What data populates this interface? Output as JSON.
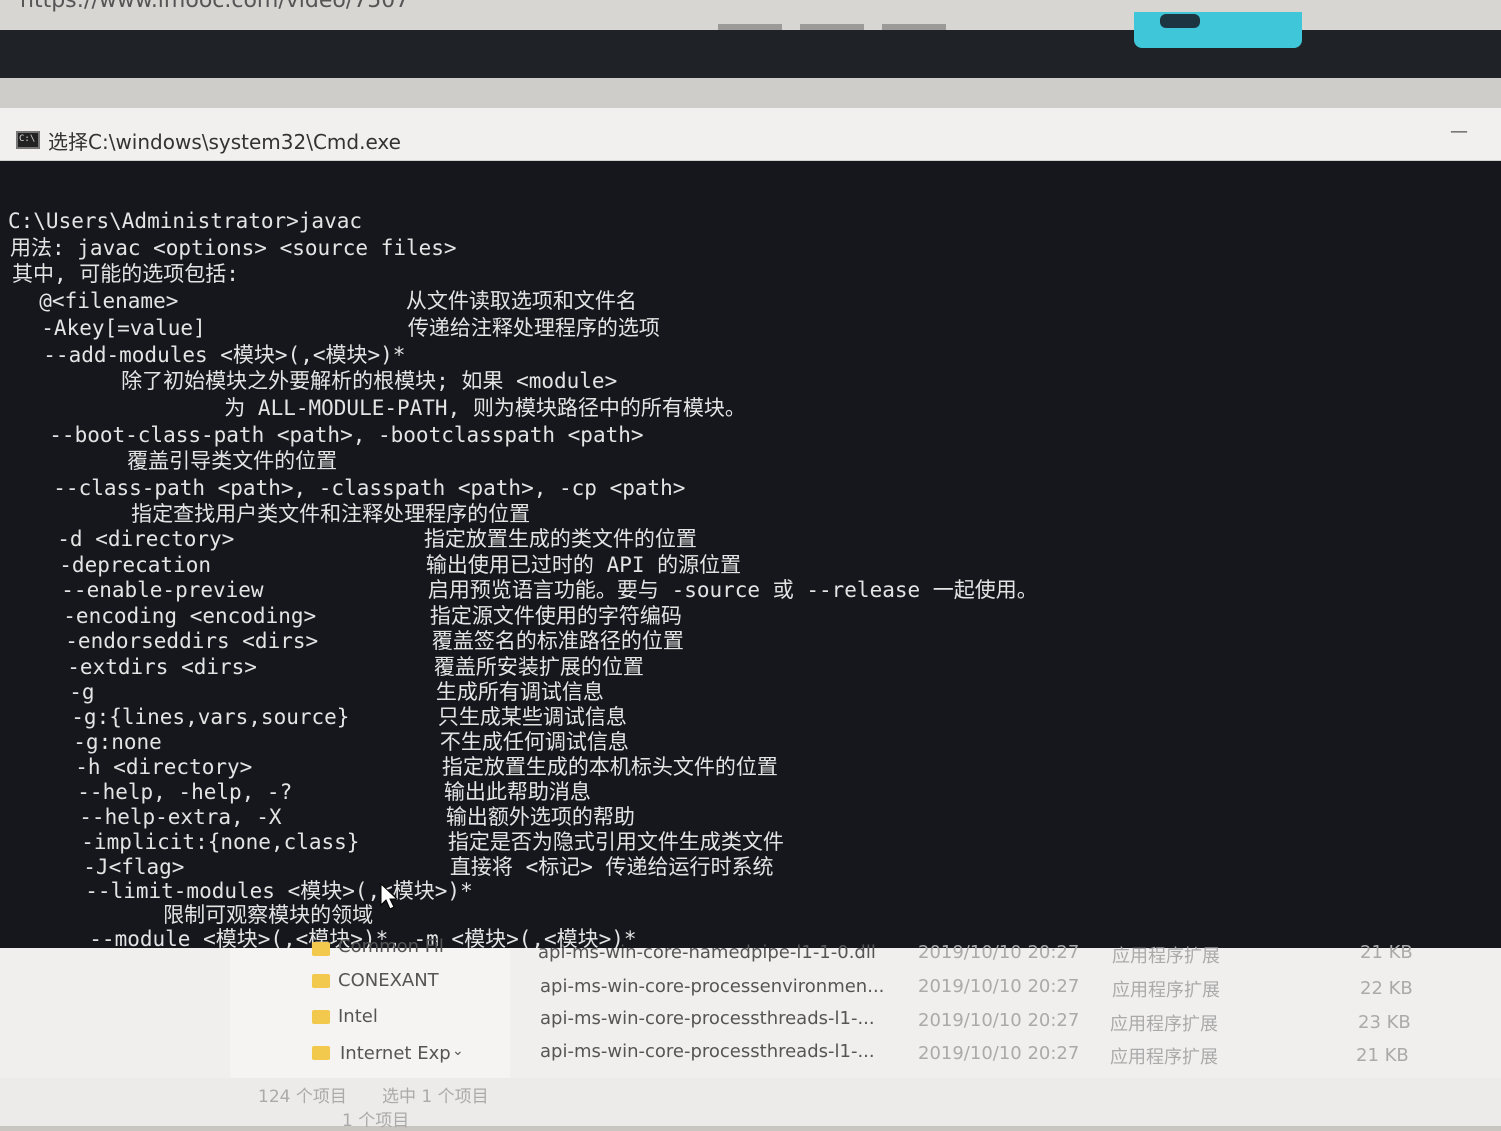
{
  "browser": {
    "url": "https://www.imooc.com/video/7507"
  },
  "window": {
    "title": "选择C:\\windows\\system32\\Cmd.exe",
    "minimize_glyph": "—"
  },
  "console": {
    "lines": [
      "C:\\Users\\Administrator>javac",
      "用法: javac <options> <source files>",
      "其中, 可能的选项包括:",
      "  @<filename>                  从文件读取选项和文件名",
      "  -Akey[=value]                传递给注释处理程序的选项",
      "  --add-modules <模块>(,<模块>)*",
      "        除了初始模块之外要解析的根模块; 如果 <module>",
      "                为 ALL-MODULE-PATH, 则为模块路径中的所有模块。",
      "  --boot-class-path <path>, -bootclasspath <path>",
      "        覆盖引导类文件的位置",
      "  --class-path <path>, -classpath <path>, -cp <path>",
      "        指定查找用户类文件和注释处理程序的位置",
      "  -d <directory>               指定放置生成的类文件的位置",
      "  -deprecation                 输出使用已过时的 API 的源位置",
      "  --enable-preview             启用预览语言功能。要与 -source 或 --release 一起使用。",
      "  -encoding <encoding>         指定源文件使用的字符编码",
      "  -endorseddirs <dirs>         覆盖签名的标准路径的位置",
      "  -extdirs <dirs>              覆盖所安装扩展的位置",
      "  -g                           生成所有调试信息",
      "  -g:{lines,vars,source}       只生成某些调试信息",
      "  -g:none                      不生成任何调试信息",
      "  -h <directory>               指定放置生成的本机标头文件的位置",
      "  --help, -help, -?            输出此帮助消息",
      "  --help-extra, -X             输出额外选项的帮助",
      "  -implicit:{none,class}       指定是否为隐式引用文件生成类文件",
      "  -J<flag>                     直接将 <标记> 传递给运行时系统",
      "  --limit-modules <模块>(,<模块>)*",
      "        限制可观察模块的领域",
      "  --module <模块>(,<模块>)*, -m <模块>(,<模块>)*"
    ]
  },
  "explorer": {
    "folders": [
      "Common Fil",
      "CONEXANT",
      "Intel",
      "Internet Exp"
    ],
    "files": [
      {
        "name": "api-ms-win-core-namedpipe-l1-1-0.dll",
        "date": "2019/10/10 20:27",
        "type": "应用程序扩展",
        "size": "21 KB"
      },
      {
        "name": "api-ms-win-core-processenvironmen...",
        "date": "2019/10/10 20:27",
        "type": "应用程序扩展",
        "size": "22 KB"
      },
      {
        "name": "api-ms-win-core-processthreads-l1-...",
        "date": "2019/10/10 20:27",
        "type": "应用程序扩展",
        "size": "23 KB"
      },
      {
        "name": "api-ms-win-core-processthreads-l1-...",
        "date": "2019/10/10 20:27",
        "type": "应用程序扩展",
        "size": "21 KB"
      }
    ],
    "status_count": "124 个项目",
    "status_selected": "选中 1 个项目",
    "status_partial": "1 个项目"
  }
}
